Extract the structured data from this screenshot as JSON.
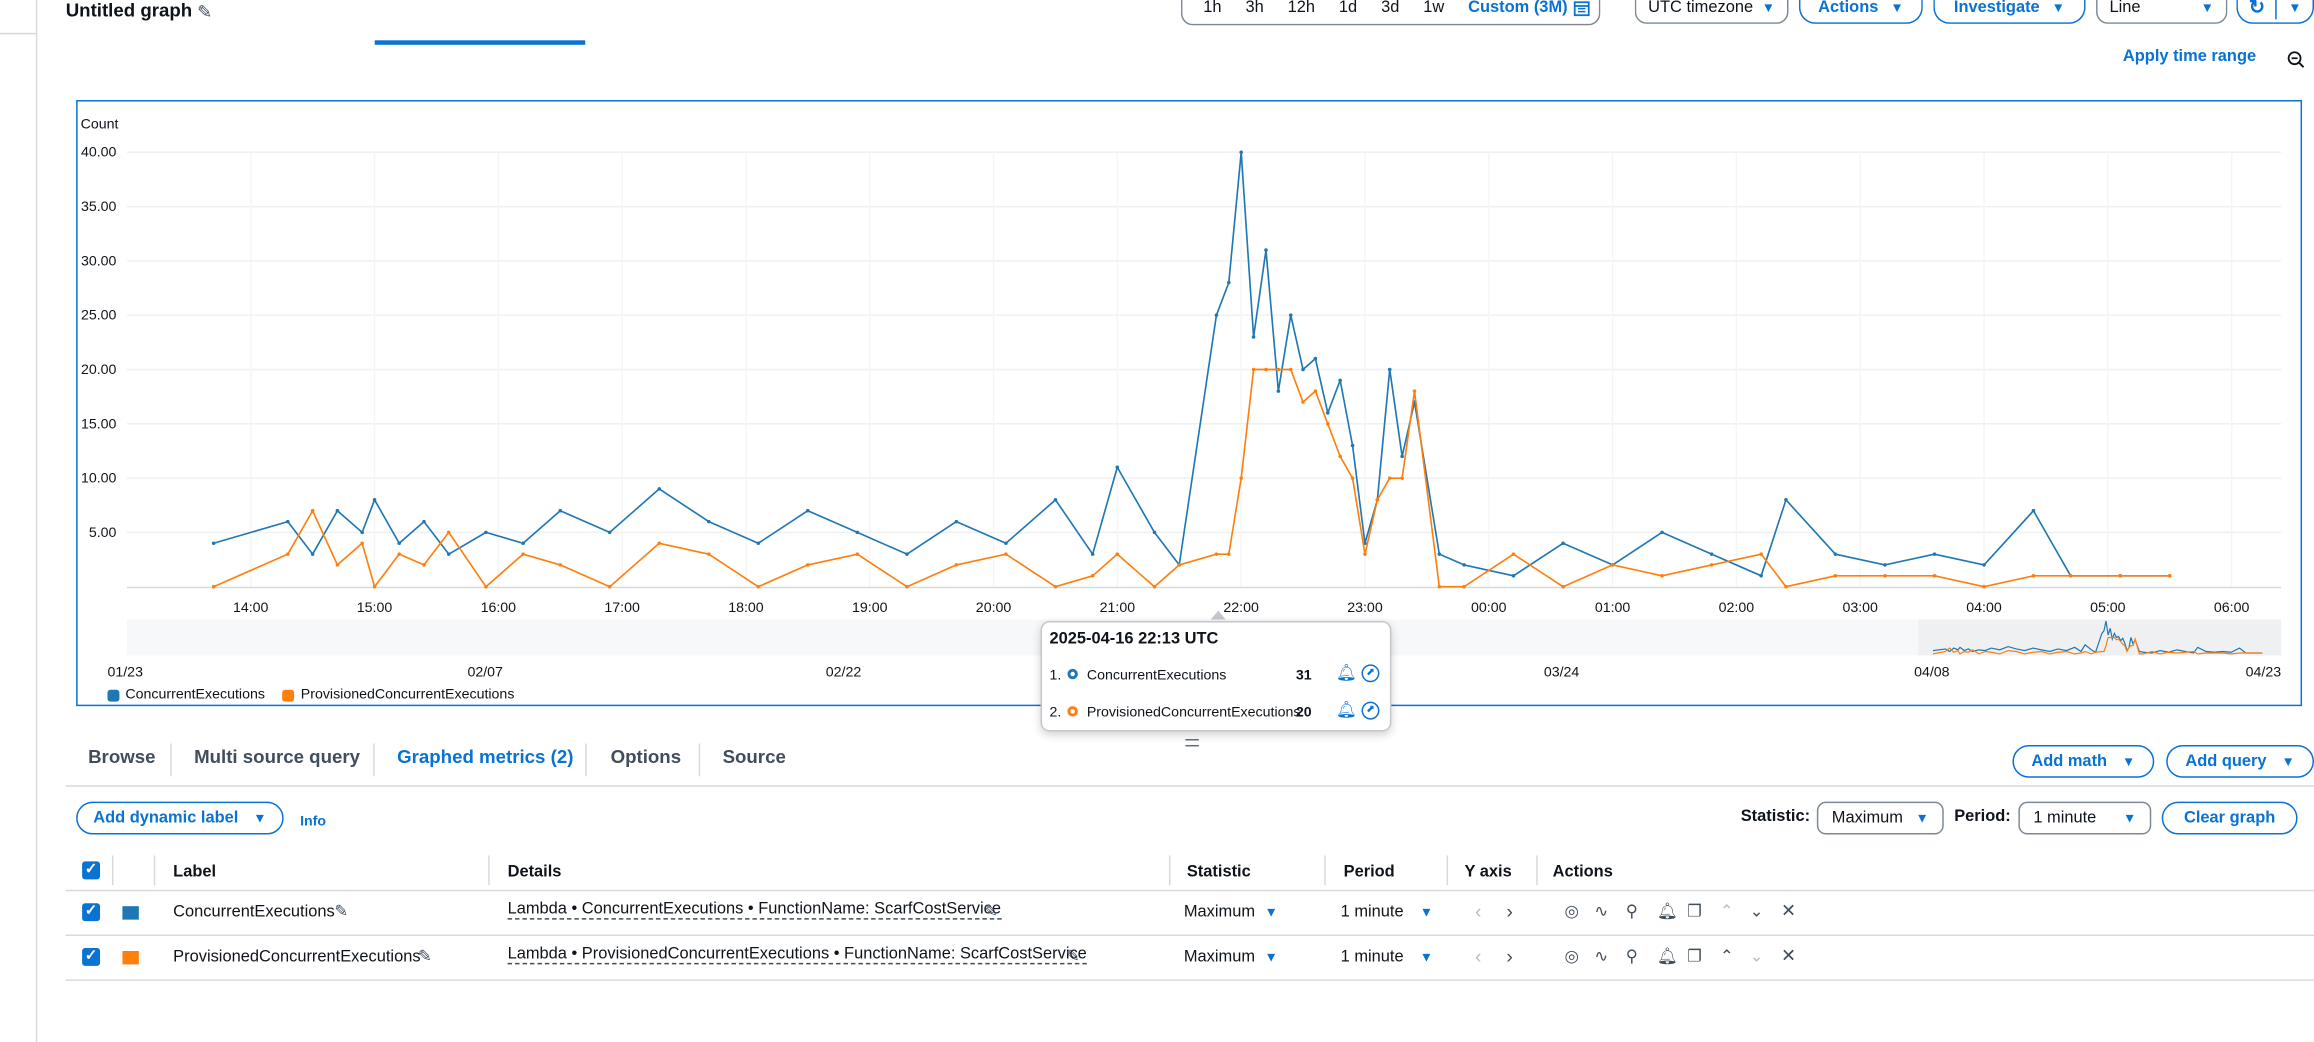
{
  "header": {
    "title": "Untitled graph",
    "time_ranges": [
      "1h",
      "3h",
      "12h",
      "1d",
      "3d",
      "1w"
    ],
    "custom_range": "Custom (3M)",
    "timezone": "UTC timezone",
    "actions_label": "Actions",
    "investigate_label": "Investigate",
    "graph_type": "Line",
    "apply_time_range": "Apply time range"
  },
  "chart_data": {
    "type": "line",
    "ylabel": "Count",
    "ylim": [
      0,
      40
    ],
    "y_ticks": [
      "40.00",
      "35.00",
      "30.00",
      "25.00",
      "20.00",
      "15.00",
      "10.00",
      "5.00"
    ],
    "x_ticks": [
      "14:00",
      "15:00",
      "16:00",
      "17:00",
      "18:00",
      "19:00",
      "20:00",
      "21:00",
      "22:00",
      "23:00",
      "00:00",
      "01:00",
      "02:00",
      "03:00",
      "04:00",
      "05:00",
      "06:00"
    ],
    "overview_ticks": [
      "01/23",
      "02/07",
      "02/22",
      "03/24",
      "04/08",
      "04/23"
    ],
    "grid": true,
    "legend_position": "bottom-left",
    "series": [
      {
        "name": "ConcurrentExecutions",
        "color": "#1f77b4",
        "x": [
          13.7,
          14.3,
          14.5,
          14.7,
          14.9,
          15.0,
          15.2,
          15.4,
          15.6,
          15.9,
          16.2,
          16.5,
          16.9,
          17.3,
          17.7,
          18.1,
          18.5,
          18.9,
          19.3,
          19.7,
          20.1,
          20.5,
          20.8,
          21.0,
          21.3,
          21.5,
          21.8,
          21.9,
          22.0,
          22.1,
          22.2,
          22.3,
          22.4,
          22.5,
          22.6,
          22.7,
          22.8,
          22.9,
          23.0,
          23.1,
          23.2,
          23.3,
          23.4,
          23.6,
          23.8,
          24.2,
          24.6,
          25.0,
          25.4,
          25.8,
          26.2,
          26.4,
          26.8,
          27.2,
          27.6,
          28.0,
          28.4,
          28.7,
          29.1,
          29.5
        ],
        "y": [
          4,
          6,
          3,
          7,
          5,
          8,
          4,
          6,
          3,
          5,
          4,
          7,
          5,
          9,
          6,
          4,
          7,
          5,
          3,
          6,
          4,
          8,
          3,
          11,
          5,
          2,
          25,
          28,
          40,
          23,
          31,
          18,
          25,
          20,
          21,
          16,
          19,
          13,
          4,
          8,
          20,
          12,
          17,
          3,
          2,
          1,
          4,
          2,
          5,
          3,
          1,
          8,
          3,
          2,
          3,
          2,
          7,
          1,
          1,
          1
        ]
      },
      {
        "name": "ProvisionedConcurrentExecutions",
        "color": "#ff7f0e",
        "x": [
          13.7,
          14.3,
          14.5,
          14.7,
          14.9,
          15.0,
          15.2,
          15.4,
          15.6,
          15.9,
          16.2,
          16.5,
          16.9,
          17.3,
          17.7,
          18.1,
          18.5,
          18.9,
          19.3,
          19.7,
          20.1,
          20.5,
          20.8,
          21.0,
          21.3,
          21.5,
          21.8,
          21.9,
          22.0,
          22.1,
          22.2,
          22.3,
          22.4,
          22.5,
          22.6,
          22.7,
          22.8,
          22.9,
          23.0,
          23.1,
          23.2,
          23.3,
          23.4,
          23.6,
          23.8,
          24.2,
          24.6,
          25.0,
          25.4,
          25.8,
          26.2,
          26.4,
          26.8,
          27.2,
          27.6,
          28.0,
          28.4,
          28.7,
          29.1,
          29.5
        ],
        "y": [
          0,
          3,
          7,
          2,
          4,
          0,
          3,
          2,
          5,
          0,
          3,
          2,
          0,
          4,
          3,
          0,
          2,
          3,
          0,
          2,
          3,
          0,
          1,
          3,
          0,
          2,
          3,
          3,
          10,
          20,
          20,
          20,
          20,
          17,
          18,
          15,
          12,
          10,
          3,
          8,
          10,
          10,
          18,
          0,
          0,
          3,
          0,
          2,
          1,
          2,
          3,
          0,
          1,
          1,
          1,
          0,
          1,
          1,
          1,
          1
        ]
      }
    ]
  },
  "tooltip": {
    "timestamp": "2025-04-16 22:13 UTC",
    "items": [
      {
        "index": "1.",
        "name": "ConcurrentExecutions",
        "value": "31"
      },
      {
        "index": "2.",
        "name": "ProvisionedConcurrentExecutions",
        "value": "20"
      }
    ]
  },
  "tabs": [
    "Browse",
    "Multi source query",
    "Graphed metrics (2)",
    "Options",
    "Source"
  ],
  "toolbar": {
    "add_math": "Add math",
    "add_query": "Add query",
    "add_dynamic_label": "Add dynamic label",
    "info": "Info",
    "statistic_label": "Statistic:",
    "statistic_value": "Maximum",
    "period_label": "Period:",
    "period_value": "1 minute",
    "clear_graph": "Clear graph"
  },
  "table": {
    "columns": [
      "Label",
      "Details",
      "Statistic",
      "Period",
      "Y axis",
      "Actions"
    ],
    "rows": [
      {
        "label": "ConcurrentExecutions",
        "details": "Lambda • ConcurrentExecutions • FunctionName: ScarfCostService",
        "statistic": "Maximum",
        "period": "1 minute",
        "color": "#1f77b4"
      },
      {
        "label": "ProvisionedConcurrentExecutions",
        "details": "Lambda • ProvisionedConcurrentExecutions • FunctionName: ScarfCostService",
        "statistic": "Maximum",
        "period": "1 minute",
        "color": "#ff7f0e"
      }
    ]
  }
}
